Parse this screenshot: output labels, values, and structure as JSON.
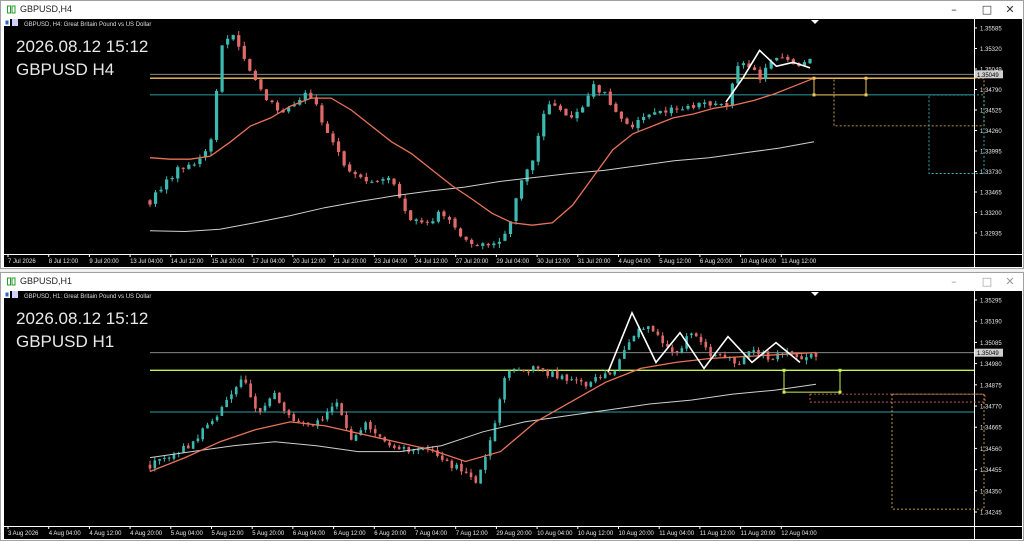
{
  "windows": [
    {
      "id": "h4",
      "title": "GBPUSD,H4",
      "header": "GBPUSD, H4:  Great Britain Pound vs US Dollar",
      "overlay_time": "2026.08.12 15:12",
      "overlay_symbol": "GBPUSD H4",
      "price_labels": [
        "1.35585",
        "1.35320",
        "1.35049",
        "1.34790",
        "1.34525",
        "1.34260",
        "1.33995",
        "1.33730",
        "1.33465",
        "1.33200",
        "1.32935"
      ],
      "time_labels": [
        "7 Jul 2026",
        "8 Jul 12:00",
        "9 Jul 20:00",
        "13 Jul 04:00",
        "14 Jul 12:00",
        "15 Jul 20:00",
        "17 Jul 04:00",
        "20 Jul 12:00",
        "21 Jul 20:00",
        "23 Jul 04:00",
        "24 Jul 12:00",
        "27 Jul 20:00",
        "29 Jul 04:00",
        "30 Jul 12:00",
        "31 Jul 20:00",
        "4 Aug 04:00",
        "5 Aug 12:00",
        "6 Aug 20:00",
        "10 Aug 04:00",
        "11 Aug 12:00"
      ],
      "current_price": "1.35049"
    },
    {
      "id": "h1",
      "title": "GBPUSD,H1",
      "header": "GBPUSD, H1:  Great Britain Pound vs US Dollar",
      "overlay_time": "2026.08.12 15:12",
      "overlay_symbol": "GBPUSD H1",
      "price_labels": [
        "1.35295",
        "1.35190",
        "1.35085",
        "1.34980",
        "1.34875",
        "1.34770",
        "1.34665",
        "1.34560",
        "1.34455",
        "1.34350",
        "1.34245"
      ],
      "time_labels": [
        "3 Aug 2026",
        "4 Aug 04:00",
        "4 Aug 12:00",
        "4 Aug 20:00",
        "5 Aug 04:00",
        "5 Aug 12:00",
        "5 Aug 20:00",
        "6 Aug 04:00",
        "6 Aug 12:00",
        "6 Aug 20:00",
        "7 Aug 04:00",
        "7 Aug 12:00",
        "29 Aug 20:00",
        "10 Aug 04:00",
        "10 Aug 12:00",
        "10 Aug 20:00",
        "11 Aug 04:00",
        "11 Aug 12:00",
        "11 Aug 20:00",
        "12 Aug 04:00"
      ],
      "current_price": "1.35049"
    }
  ],
  "colors": {
    "background": "#000000",
    "bull": "#3cb9b0",
    "bear": "#e06a6a",
    "ma_fast": "#e8725a",
    "ma_slow": "#cfcfcf",
    "zigzag": "#ffffff",
    "level_gray": "#9a9a9a",
    "level_orange": "#f5c35a",
    "level_cyan": "#3ad0d8",
    "level_lime": "#c8f050"
  },
  "chart_data": [
    {
      "type": "candlestick",
      "symbol": "GBPUSD",
      "timeframe": "H4",
      "ylim": [
        1.328,
        1.3572
      ],
      "close_path": [
        1.3345,
        1.336,
        1.3382,
        1.3388,
        1.3395,
        1.341,
        1.354,
        1.3555,
        1.352,
        1.349,
        1.347,
        1.346,
        1.347,
        1.3482,
        1.346,
        1.3425,
        1.3395,
        1.338,
        1.337,
        1.3372,
        1.338,
        1.334,
        1.332,
        1.3315,
        1.333,
        1.332,
        1.33,
        1.329,
        1.3295,
        1.329,
        1.332,
        1.337,
        1.34,
        1.347,
        1.346,
        1.345,
        1.346,
        1.349,
        1.348,
        1.345,
        1.344,
        1.345,
        1.3455,
        1.346,
        1.3465,
        1.3462,
        1.347,
        1.347,
        1.346,
        1.352,
        1.351,
        1.35,
        1.353,
        1.352,
        1.3515,
        1.352
      ],
      "ma_fast": [
        1.34,
        1.3398,
        1.3398,
        1.3402,
        1.342,
        1.344,
        1.345,
        1.3465,
        1.3475,
        1.3475,
        1.346,
        1.344,
        1.342,
        1.3405,
        1.3385,
        1.3365,
        1.3348,
        1.333,
        1.3318,
        1.3315,
        1.3318,
        1.334,
        1.3375,
        1.341,
        1.343,
        1.344,
        1.345,
        1.3455,
        1.3462,
        1.3466,
        1.3472,
        1.348,
        1.349,
        1.35
      ],
      "ma_slow": [
        1.3308,
        1.3307,
        1.331,
        1.3318,
        1.3327,
        1.3337,
        1.3345,
        1.3352,
        1.3358,
        1.3363,
        1.337,
        1.3375,
        1.338,
        1.3384,
        1.339,
        1.3396,
        1.34,
        1.3406,
        1.3412,
        1.342
      ],
      "zigzag": [
        1.347,
        1.35,
        1.3535,
        1.3515,
        1.352,
        1.3513
      ],
      "levels": [
        1.35049,
        1.35,
        1.3479
      ]
    },
    {
      "type": "candlestick",
      "symbol": "GBPUSD",
      "timeframe": "H1",
      "ylim": [
        1.3418,
        1.3535
      ],
      "close_path": [
        1.3448,
        1.3452,
        1.3455,
        1.3462,
        1.347,
        1.348,
        1.3492,
        1.3475,
        1.3485,
        1.3472,
        1.3468,
        1.347,
        1.348,
        1.3462,
        1.347,
        1.346,
        1.3458,
        1.3455,
        1.3458,
        1.345,
        1.3446,
        1.344,
        1.346,
        1.3495,
        1.3497,
        1.3497,
        1.3494,
        1.3492,
        1.3489,
        1.3492,
        1.3497,
        1.351,
        1.352,
        1.3512,
        1.3505,
        1.3515,
        1.3505,
        1.3502,
        1.35,
        1.3506,
        1.3502,
        1.3505,
        1.3503,
        1.3503
      ],
      "ma_fast": [
        1.3445,
        1.3452,
        1.346,
        1.3466,
        1.347,
        1.3468,
        1.3464,
        1.346,
        1.3456,
        1.345,
        1.3455,
        1.347,
        1.348,
        1.349,
        1.3497,
        1.35,
        1.3502,
        1.3503,
        1.3504,
        1.3505
      ],
      "ma_slow": [
        1.3452,
        1.3455,
        1.3458,
        1.346,
        1.3458,
        1.3455,
        1.3455,
        1.3458,
        1.3465,
        1.347,
        1.3473,
        1.3476,
        1.3479,
        1.3481,
        1.3484,
        1.3486,
        1.3489
      ],
      "zigzag": [
        1.3495,
        1.3525,
        1.35,
        1.3515,
        1.3497,
        1.3513,
        1.35,
        1.351,
        1.35
      ],
      "levels": [
        1.35049,
        1.3496,
        1.3475
      ]
    }
  ]
}
